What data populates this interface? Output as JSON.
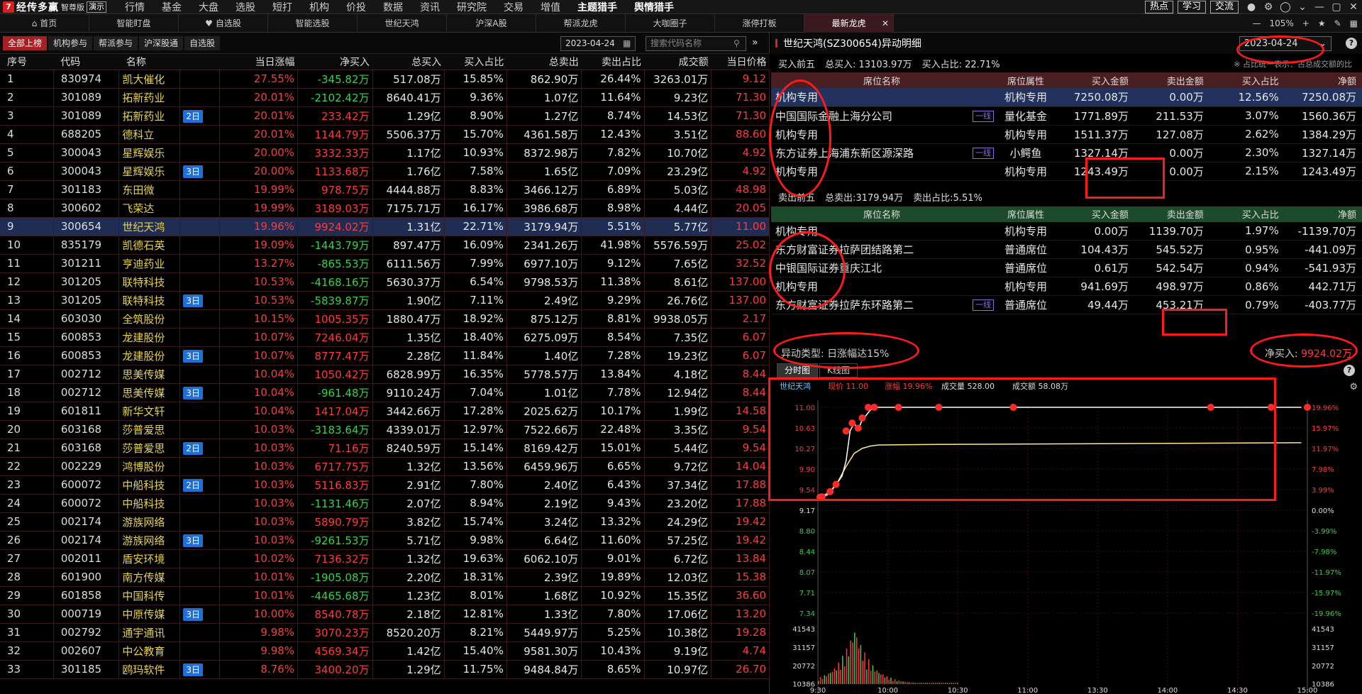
{
  "top": {
    "logo_text": "经传多赢",
    "edition": "智尊版",
    "demo": "演示",
    "menu": [
      "行情",
      "基金",
      "大盘",
      "选股",
      "短打",
      "机构",
      "价投",
      "数据",
      "资讯",
      "研究院",
      "交易",
      "增值",
      "主题猎手",
      "舆情猎手"
    ],
    "right_buttons": [
      "热点",
      "学习",
      "交流"
    ]
  },
  "tabs": {
    "items": [
      "首页",
      "智能盯盘",
      "自选股",
      "智能选股",
      "世纪天鸿",
      "沪深A股",
      "帮派龙虎",
      "大咖圈子",
      "涨停打板",
      "最新龙虎"
    ],
    "active": "最新龙虎",
    "zoom": "105%"
  },
  "left": {
    "filters": [
      "全部上榜",
      "机构参与",
      "帮派参与",
      "沪深股通",
      "自选股"
    ],
    "date": "2023-04-24",
    "search_placeholder": "搜索代码名称",
    "columns": [
      "序号",
      "代码",
      "名称",
      "",
      "当日涨幅",
      "净买入",
      "总买入",
      "买入占比",
      "总卖出",
      "卖出占比",
      "成交额",
      "当日价格"
    ],
    "rows": [
      [
        "1",
        "830974",
        "凯大催化",
        "",
        "27.55%",
        "-345.82万",
        "517.08万",
        "15.85%",
        "862.90万",
        "26.44%",
        "3263.01万",
        "9.12"
      ],
      [
        "2",
        "301089",
        "拓新药业",
        "",
        "20.01%",
        "-2102.42万",
        "8640.41万",
        "9.36%",
        "1.07亿",
        "11.64%",
        "9.23亿",
        "71.30"
      ],
      [
        "3",
        "301089",
        "拓新药业",
        "2日",
        "20.01%",
        "233.42万",
        "1.29亿",
        "8.90%",
        "1.27亿",
        "8.74%",
        "14.53亿",
        "71.30"
      ],
      [
        "4",
        "688205",
        "德科立",
        "",
        "20.01%",
        "1144.79万",
        "5506.37万",
        "15.70%",
        "4361.58万",
        "12.43%",
        "3.51亿",
        "88.60"
      ],
      [
        "5",
        "300043",
        "星辉娱乐",
        "",
        "20.00%",
        "3332.33万",
        "1.17亿",
        "10.93%",
        "8372.98万",
        "7.82%",
        "10.70亿",
        "4.92"
      ],
      [
        "6",
        "300043",
        "星辉娱乐",
        "3日",
        "20.00%",
        "1133.68万",
        "1.76亿",
        "7.58%",
        "1.65亿",
        "7.09%",
        "23.29亿",
        "4.92"
      ],
      [
        "7",
        "301183",
        "东田微",
        "",
        "19.99%",
        "978.75万",
        "4444.88万",
        "8.83%",
        "3466.12万",
        "6.89%",
        "5.03亿",
        "48.98"
      ],
      [
        "8",
        "300602",
        "飞荣达",
        "",
        "19.99%",
        "3189.03万",
        "7175.71万",
        "16.17%",
        "3986.68万",
        "8.98%",
        "4.44亿",
        "20.05"
      ],
      [
        "9",
        "300654",
        "世纪天鸿",
        "",
        "19.96%",
        "9924.02万",
        "1.31亿",
        "22.71%",
        "3179.94万",
        "5.51%",
        "5.77亿",
        "11.00"
      ],
      [
        "10",
        "835179",
        "凯德石英",
        "",
        "19.09%",
        "-1443.79万",
        "897.47万",
        "16.09%",
        "2341.26万",
        "41.98%",
        "5576.59万",
        "25.02"
      ],
      [
        "11",
        "301211",
        "亨迪药业",
        "",
        "13.27%",
        "-865.53万",
        "6111.56万",
        "7.99%",
        "6977.10万",
        "9.12%",
        "7.65亿",
        "32.52"
      ],
      [
        "12",
        "301205",
        "联特科技",
        "",
        "10.53%",
        "-4168.16万",
        "5630.37万",
        "6.54%",
        "9798.53万",
        "11.38%",
        "8.61亿",
        "137.00"
      ],
      [
        "13",
        "301205",
        "联特科技",
        "3日",
        "10.53%",
        "-5839.87万",
        "1.90亿",
        "7.11%",
        "2.49亿",
        "9.29%",
        "26.76亿",
        "137.00"
      ],
      [
        "14",
        "603030",
        "全筑股份",
        "",
        "10.15%",
        "1005.35万",
        "1880.47万",
        "18.92%",
        "875.12万",
        "8.81%",
        "9938.05万",
        "2.17"
      ],
      [
        "15",
        "600853",
        "龙建股份",
        "",
        "10.07%",
        "7246.04万",
        "1.35亿",
        "18.40%",
        "6275.09万",
        "8.54%",
        "7.35亿",
        "6.07"
      ],
      [
        "16",
        "600853",
        "龙建股份",
        "3日",
        "10.07%",
        "8777.47万",
        "2.28亿",
        "11.84%",
        "1.40亿",
        "7.28%",
        "19.23亿",
        "6.07"
      ],
      [
        "17",
        "002712",
        "思美传媒",
        "",
        "10.04%",
        "1050.42万",
        "6828.99万",
        "16.35%",
        "5778.57万",
        "13.84%",
        "4.18亿",
        "8.44"
      ],
      [
        "18",
        "002712",
        "思美传媒",
        "3日",
        "10.04%",
        "-961.48万",
        "9110.24万",
        "7.04%",
        "1.01亿",
        "7.78%",
        "12.94亿",
        "8.44"
      ],
      [
        "19",
        "601811",
        "新华文轩",
        "",
        "10.04%",
        "1417.04万",
        "3442.66万",
        "17.28%",
        "2025.62万",
        "10.17%",
        "1.99亿",
        "14.58"
      ],
      [
        "20",
        "603168",
        "莎普爱思",
        "",
        "10.03%",
        "-3183.64万",
        "4339.01万",
        "12.97%",
        "7522.66万",
        "22.48%",
        "3.35亿",
        "9.54"
      ],
      [
        "21",
        "603168",
        "莎普爱思",
        "2日",
        "10.03%",
        "71.16万",
        "8240.59万",
        "15.14%",
        "8169.42万",
        "15.01%",
        "5.44亿",
        "9.54"
      ],
      [
        "22",
        "002229",
        "鸿博股份",
        "",
        "10.03%",
        "6717.75万",
        "1.32亿",
        "13.56%",
        "6459.96万",
        "6.65%",
        "9.72亿",
        "14.04"
      ],
      [
        "23",
        "600072",
        "中船科技",
        "2日",
        "10.03%",
        "5116.83万",
        "2.91亿",
        "7.80%",
        "2.40亿",
        "6.43%",
        "37.34亿",
        "17.88"
      ],
      [
        "24",
        "600072",
        "中船科技",
        "",
        "10.03%",
        "-1131.46万",
        "2.07亿",
        "8.94%",
        "2.19亿",
        "9.43%",
        "23.20亿",
        "17.88"
      ],
      [
        "25",
        "002174",
        "游族网络",
        "",
        "10.03%",
        "5890.79万",
        "3.82亿",
        "15.74%",
        "3.24亿",
        "13.32%",
        "24.29亿",
        "19.42"
      ],
      [
        "26",
        "002174",
        "游族网络",
        "3日",
        "10.03%",
        "-9261.53万",
        "5.71亿",
        "9.98%",
        "6.64亿",
        "11.60%",
        "57.25亿",
        "19.42"
      ],
      [
        "27",
        "002011",
        "盾安环境",
        "",
        "10.02%",
        "7136.32万",
        "1.32亿",
        "19.63%",
        "6062.10万",
        "9.01%",
        "6.72亿",
        "13.84"
      ],
      [
        "28",
        "601900",
        "南方传媒",
        "",
        "10.01%",
        "-1905.08万",
        "2.20亿",
        "18.31%",
        "2.39亿",
        "19.89%",
        "12.03亿",
        "15.38"
      ],
      [
        "29",
        "601858",
        "中国科传",
        "",
        "10.01%",
        "-4465.68万",
        "1.23亿",
        "8.01%",
        "1.68亿",
        "10.92%",
        "15.35亿",
        "36.60"
      ],
      [
        "30",
        "000719",
        "中原传媒",
        "3日",
        "10.00%",
        "8540.78万",
        "2.18亿",
        "12.81%",
        "1.33亿",
        "7.80%",
        "17.06亿",
        "13.20"
      ],
      [
        "31",
        "002792",
        "通宇通讯",
        "",
        "9.98%",
        "3070.23万",
        "8520.20万",
        "8.21%",
        "5449.97万",
        "5.25%",
        "10.38亿",
        "19.28"
      ],
      [
        "32",
        "002607",
        "中公教育",
        "",
        "9.98%",
        "4569.34万",
        "1.42亿",
        "15.40%",
        "9581.30万",
        "10.43%",
        "9.19亿",
        "4.74"
      ],
      [
        "33",
        "301185",
        "鸥玛软件",
        "3日",
        "8.76%",
        "3400.20万",
        "1.29亿",
        "11.75%",
        "9484.84万",
        "8.65%",
        "10.97亿",
        "26.70"
      ]
    ]
  },
  "right": {
    "title": "世纪天鸿(SZ300654)异动明细",
    "date": "2023-04-24",
    "buy": {
      "label": "买入前五",
      "total": "总买入: 13103.97万",
      "ratio": "买入占比: 22.71%",
      "note": "※ 占比统一表示：占总成交额的比",
      "columns": [
        "席位名称",
        "席位属性",
        "买入金额",
        "卖出金额",
        "买入占比",
        "净额"
      ],
      "rows": [
        [
          "机构专用",
          "",
          "机构专用",
          "7250.08万",
          "0.00万",
          "12.56%",
          "7250.08万"
        ],
        [
          "中国国际金融上海分公司",
          "一线",
          "量化基金",
          "1771.89万",
          "211.53万",
          "3.07%",
          "1560.36万"
        ],
        [
          "机构专用",
          "",
          "机构专用",
          "1511.37万",
          "127.08万",
          "2.62%",
          "1384.29万"
        ],
        [
          "东方证券上海浦东新区源深路",
          "一线",
          "小鳄鱼",
          "1327.14万",
          "0.00万",
          "2.30%",
          "1327.14万"
        ],
        [
          "机构专用",
          "",
          "机构专用",
          "1243.49万",
          "0.00万",
          "2.15%",
          "1243.49万"
        ]
      ]
    },
    "sell": {
      "label": "卖出前五",
      "total": "总卖出:3179.94万",
      "ratio": "卖出占比:5.51%",
      "columns": [
        "席位名称",
        "席位属性",
        "买入金额",
        "卖出金额",
        "买入占比",
        "净额"
      ],
      "rows": [
        [
          "机构专用",
          "",
          "机构专用",
          "0.00万",
          "1139.70万",
          "1.97%",
          "-1139.70万"
        ],
        [
          "东方财富证券拉萨团结路第二",
          "",
          "普通席位",
          "104.43万",
          "545.52万",
          "0.95%",
          "-441.09万"
        ],
        [
          "中银国际证券重庆江北",
          "",
          "普通席位",
          "0.61万",
          "542.54万",
          "0.94%",
          "-541.93万"
        ],
        [
          "机构专用",
          "",
          "机构专用",
          "941.69万",
          "498.97万",
          "0.86%",
          "442.71万"
        ],
        [
          "东方财富证券拉萨东环路第二",
          "一线",
          "普通席位",
          "49.44万",
          "453.21万",
          "0.79%",
          "-403.77万"
        ]
      ]
    },
    "abnormal_type": "异动类型: 日涨幅达15%",
    "net_buy_label": "净买入: ",
    "net_buy_value": "9924.02万",
    "chart_tabs": [
      "分时图",
      "K线图"
    ]
  },
  "chart_data": {
    "type": "line",
    "title": "",
    "legend": {
      "name": "世纪天鸿",
      "price": "现价 11.00",
      "change": "涨幅 19.96%",
      "volume": "成交量 528.00",
      "amount": "成交额 58.08万"
    },
    "x_ticks": [
      "9:30",
      "10:00",
      "10:30",
      "11:00",
      "13:30",
      "14:00",
      "14:30",
      "15:00"
    ],
    "price_ticks": [
      "11.00",
      "10.63",
      "10.27",
      "9.90",
      "9.54",
      "9.17",
      "8.80",
      "8.44",
      "8.07",
      "7.71",
      "7.34"
    ],
    "pct_ticks": [
      "19.96%",
      "15.97%",
      "11.97%",
      "7.98%",
      "3.99%",
      "0.00%",
      "-3.99%",
      "-7.98%",
      "-11.97%",
      "-15.97%",
      "-19.96%"
    ],
    "volume_ticks": [
      "41543",
      "31157",
      "20772",
      "10386"
    ],
    "ylim": [
      7.34,
      11.0
    ],
    "price_series": [
      [
        0,
        9.38
      ],
      [
        3,
        9.44
      ],
      [
        6,
        9.49
      ],
      [
        9,
        9.62
      ],
      [
        12,
        9.78
      ],
      [
        14,
        10.05
      ],
      [
        16,
        10.58
      ],
      [
        18,
        10.72
      ],
      [
        20,
        10.6
      ],
      [
        22,
        10.78
      ],
      [
        24,
        10.86
      ],
      [
        26,
        10.95
      ],
      [
        28,
        11.0
      ],
      [
        240,
        11.0
      ]
    ],
    "avg_series": [
      [
        0,
        9.35
      ],
      [
        5,
        9.45
      ],
      [
        10,
        9.68
      ],
      [
        14,
        9.95
      ],
      [
        18,
        10.18
      ],
      [
        22,
        10.27
      ],
      [
        26,
        10.31
      ],
      [
        30,
        10.33
      ],
      [
        60,
        10.34
      ],
      [
        120,
        10.35
      ],
      [
        180,
        10.36
      ],
      [
        240,
        10.37
      ]
    ],
    "markers": [
      [
        1,
        9.4
      ],
      [
        2,
        9.41
      ],
      [
        6,
        9.5
      ],
      [
        9,
        9.63
      ],
      [
        14,
        10.58
      ],
      [
        17,
        10.72
      ],
      [
        20,
        10.63
      ],
      [
        22,
        10.81
      ],
      [
        25,
        11.0
      ],
      [
        28,
        11.0
      ],
      [
        40,
        11.0
      ],
      [
        60,
        11.0
      ],
      [
        97,
        11.0
      ],
      [
        195,
        11.0
      ],
      [
        225,
        11.0
      ],
      [
        243,
        11.0
      ]
    ],
    "volume_peak": 41543
  }
}
